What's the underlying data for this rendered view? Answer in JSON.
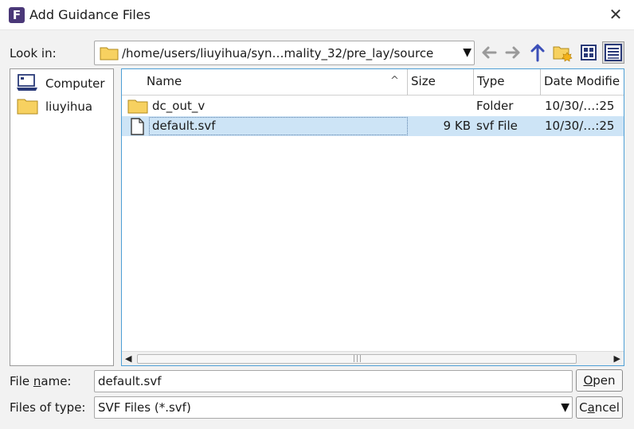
{
  "window": {
    "title": "Add Guidance Files",
    "app_icon_letter": "F",
    "close_glyph": "✕"
  },
  "look_in": {
    "label": "Look in:",
    "path": "/home/users/liuyihua/syn…mality_32/pre_lay/source"
  },
  "toolbar": {
    "buttons": [
      "back-icon",
      "forward-icon",
      "up-icon",
      "new-folder-icon",
      "list-view-icon",
      "detail-view-icon"
    ]
  },
  "sidebar": {
    "items": [
      {
        "label": "Computer",
        "icon": "computer-icon"
      },
      {
        "label": "liuyihua",
        "icon": "folder-icon"
      }
    ]
  },
  "file_list": {
    "columns": [
      "Name",
      "Size",
      "Type",
      "Date Modifie"
    ],
    "sort_indicator": "^",
    "rows": [
      {
        "name": "dc_out_v",
        "size": "",
        "type": "Folder",
        "date": "10/30/…:25",
        "icon": "folder-icon",
        "selected": false
      },
      {
        "name": "default.svf",
        "size": "9 KB",
        "type": "svf File",
        "date": "10/30/…:25",
        "icon": "file-icon",
        "selected": true
      }
    ],
    "scroll_grip": "|||"
  },
  "file_name": {
    "label_pre": "File ",
    "label_ul": "n",
    "label_post": "ame:",
    "value": "default.svf"
  },
  "file_type": {
    "label": "Files of type:",
    "value": "SVF Files (*.svf)"
  },
  "buttons": {
    "open_ul": "O",
    "open_rest": "pen",
    "cancel_pre": "C",
    "cancel_ul": "a",
    "cancel_post": "ncel"
  },
  "colors": {
    "accent": "#4e9fd6",
    "selection": "#cde4f6",
    "folder": "#f7d160",
    "app_icon": "#4a3878",
    "toolbar_blue": "#3b4fb8",
    "toolbar_gray": "#9a9a9a"
  }
}
